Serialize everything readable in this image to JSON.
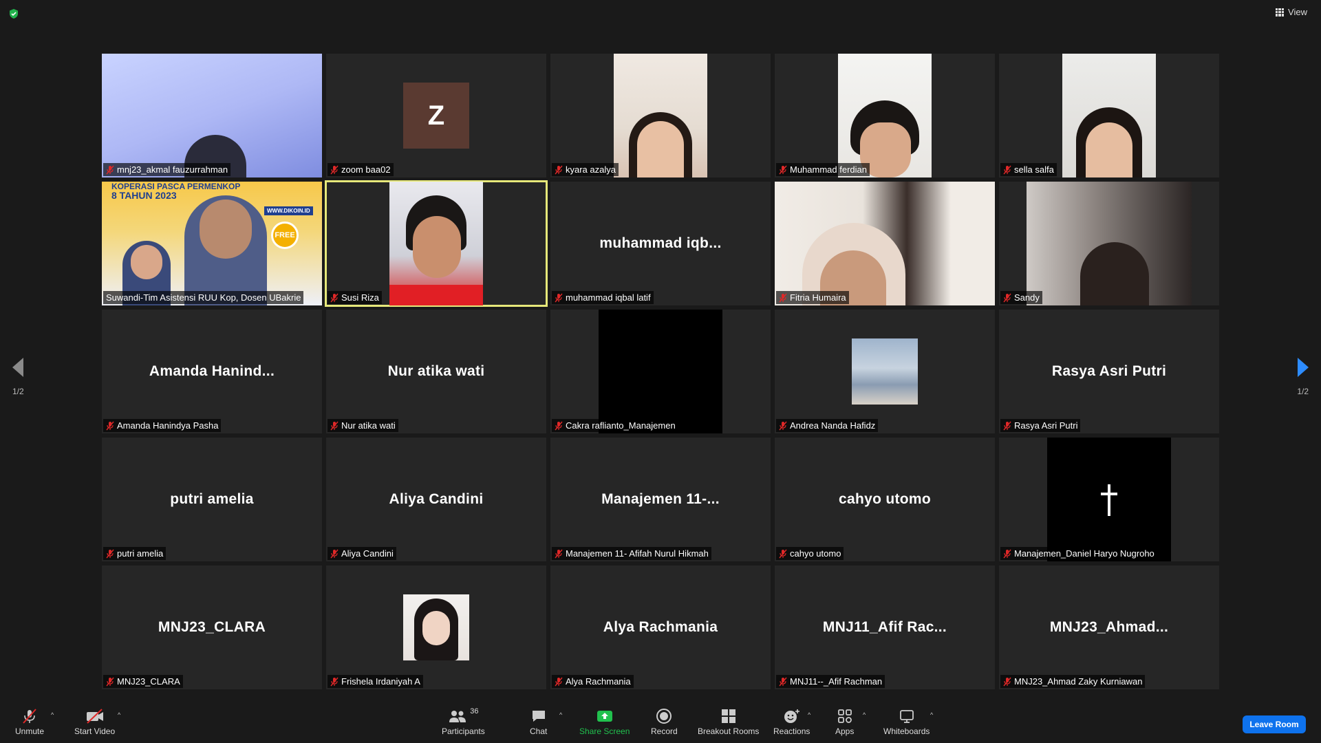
{
  "header": {
    "view_label": "View"
  },
  "pager": {
    "left_label": "1/2",
    "right_label": "1/2"
  },
  "tiles": [
    {
      "label": "mnj23_akmal fauzurrahman",
      "big": ""
    },
    {
      "label": "zoom baa02",
      "big": "",
      "avatar_letter": "Z"
    },
    {
      "label": "kyara azalya",
      "big": ""
    },
    {
      "label": "Muhammad ferdian",
      "big": ""
    },
    {
      "label": "sella salfa",
      "big": ""
    },
    {
      "label": "Suwandi-Tim Asistensi RUU Kop, Dosen UBakrie",
      "big": "",
      "slide_title_1": "KOPERASI PASCA PERMENKOP",
      "slide_title_2": "8 TAHUN 2023",
      "slide_free": "FREE",
      "slide_url": "WWW.DIKOIN.ID"
    },
    {
      "label": "Susi Riza",
      "big": ""
    },
    {
      "label": "muhammad iqbal latif",
      "big": "muhammad  iqb..."
    },
    {
      "label": "Fitria Humaira",
      "big": ""
    },
    {
      "label": "Sandy",
      "big": ""
    },
    {
      "label": "Amanda Hanindya Pasha",
      "big": "Amanda  Hanind..."
    },
    {
      "label": "Nur atika wati",
      "big": "Nur atika wati"
    },
    {
      "label": "Cakra raflianto_Manajemen",
      "big": ""
    },
    {
      "label": "Andrea Nanda Hafidz",
      "big": ""
    },
    {
      "label": "Rasya Asri Putri",
      "big": "Rasya Asri Putri"
    },
    {
      "label": "putri amelia",
      "big": "putri amelia"
    },
    {
      "label": "Aliya Candini",
      "big": "Aliya Candini"
    },
    {
      "label": "Manajemen 11- Afifah Nurul Hikmah",
      "big": "Manajemen  11-..."
    },
    {
      "label": "cahyo utomo",
      "big": "cahyo utomo"
    },
    {
      "label": "Manajemen_Daniel Haryo Nugroho",
      "big": ""
    },
    {
      "label": "MNJ23_CLARA",
      "big": "MNJ23_CLARA"
    },
    {
      "label": "Frishela Irdaniyah A",
      "big": ""
    },
    {
      "label": "Alya Rachmania",
      "big": "Alya Rachmania"
    },
    {
      "label": "MNJ11--_Afif Rachman",
      "big": "MNJ11_Afif  Rac..."
    },
    {
      "label": "MNJ23_Ahmad Zaky Kurniawan",
      "big": "MNJ23_Ahmad..."
    }
  ],
  "toolbar": {
    "unmute": "Unmute",
    "start_video": "Start Video",
    "participants": "Participants",
    "participants_count": "36",
    "chat": "Chat",
    "share_screen": "Share Screen",
    "record": "Record",
    "breakout_rooms": "Breakout Rooms",
    "reactions": "Reactions",
    "apps": "Apps",
    "whiteboards": "Whiteboards",
    "leave": "Leave Room"
  },
  "colors": {
    "accent_blue": "#0e72ed",
    "share_green": "#21c14e",
    "active_speaker": "#e6e87a",
    "mic_off_red": "#e02828"
  }
}
